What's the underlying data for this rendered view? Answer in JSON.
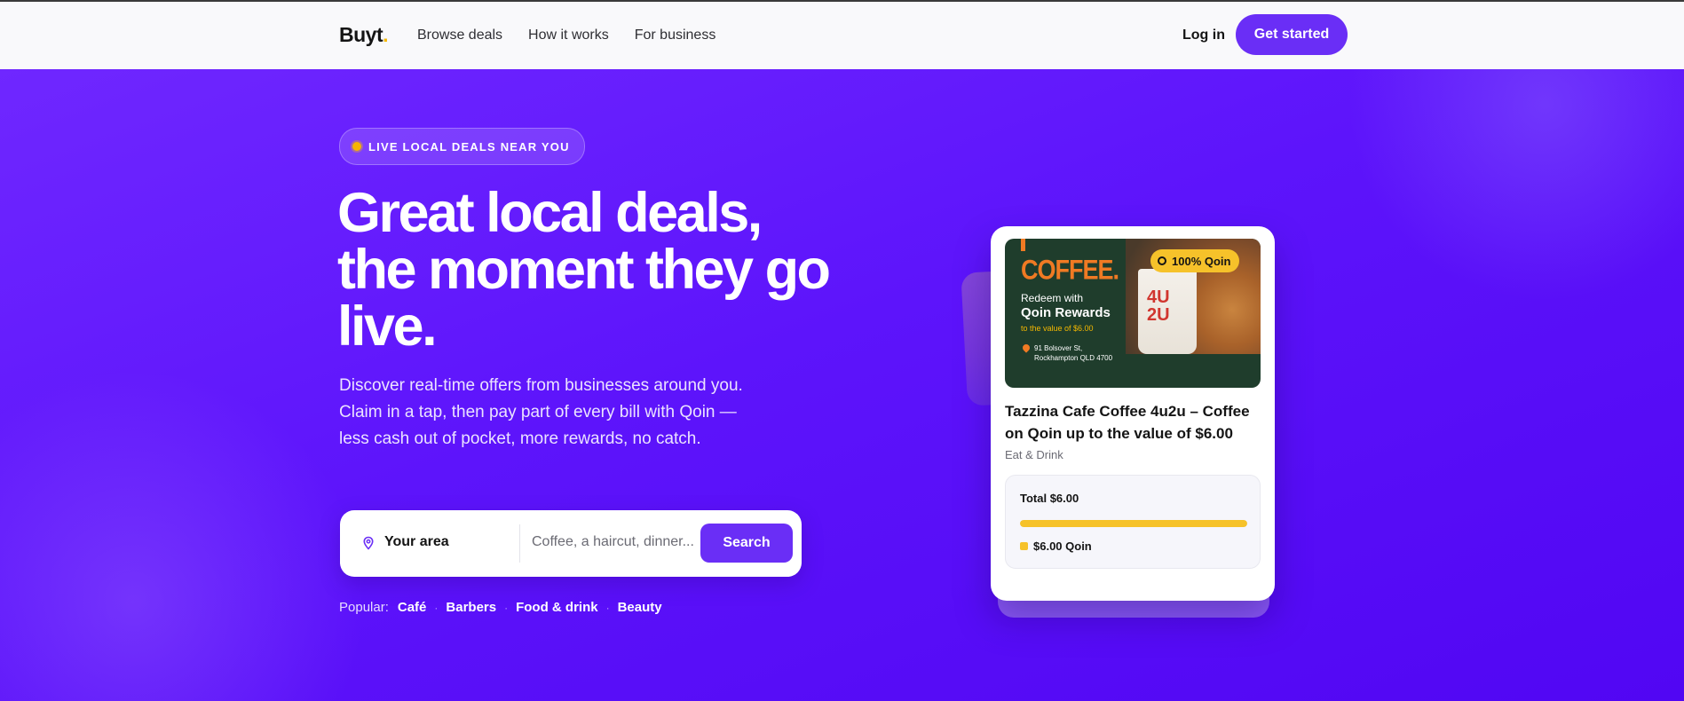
{
  "header": {
    "logo": "Buyt",
    "logo_dot": ".",
    "nav": [
      "Browse deals",
      "How it works",
      "For business"
    ],
    "login": "Log in",
    "cta": "Get started"
  },
  "hero": {
    "pill": "LIVE LOCAL DEALS NEAR YOU",
    "headline": "Great local deals, the moment they go live.",
    "subtitle": "Discover real-time offers from businesses around you. Claim in a tap, then pay part of every bill with Qoin — less cash out of pocket, more rewards, no catch.",
    "search": {
      "area_label": "Your area",
      "query_placeholder": "Coffee, a haircut, dinner...",
      "button": "Search"
    },
    "popular_label": "Popular:",
    "popular_tags": [
      "Café",
      "Barbers",
      "Food & drink",
      "Beauty"
    ]
  },
  "deal_card": {
    "image": {
      "brand": "COFFEE.",
      "redeem_line": "Redeem with",
      "rewards_line": "Qoin Rewards",
      "value_line": "to the value of $6.00",
      "address_line1": "91 Bolsover St,",
      "address_line2": "Rockhampton QLD 4700",
      "cup_text": "4U 2U",
      "badge": "100% Qoin"
    },
    "title": "Tazzina Cafe Coffee 4u2u – Coffee on Qoin up to the value of $6.00",
    "category": "Eat & Drink",
    "total": "Total $6.00",
    "qoin_fraction": 1.0,
    "qoin_amount": "$6.00 Qoin"
  },
  "colors": {
    "brand_purple": "#6a2ef6",
    "accent_yellow": "#f6c22a",
    "hero_bg": "#5d14fb"
  }
}
